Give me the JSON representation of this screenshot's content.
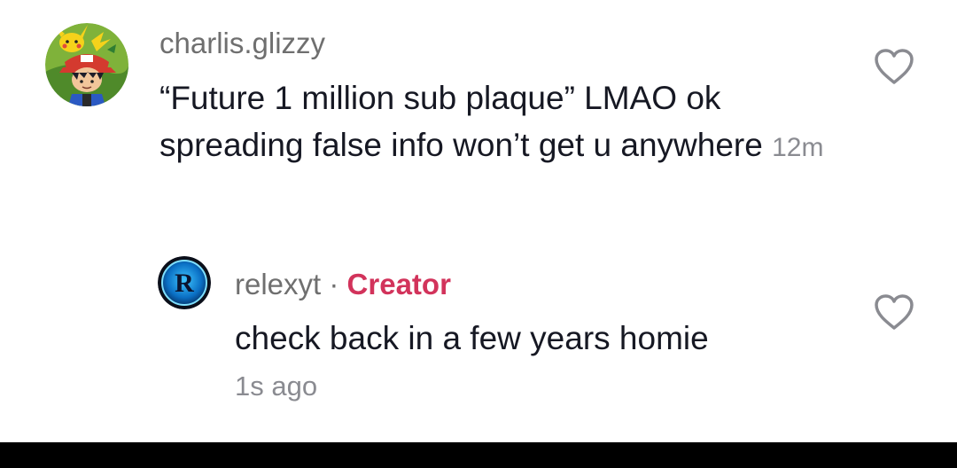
{
  "comments": [
    {
      "username": "charlis.glizzy",
      "text": "“Future 1 million sub plaque” LMAO ok spreading false info won’t get u anywhere",
      "time": "12m",
      "avatar_icon": "pikachu-ash-avatar-icon",
      "like_icon": "heart-outline-icon"
    }
  ],
  "replies": [
    {
      "username": "relexyt",
      "separator": "·",
      "badge": "Creator",
      "text": "check back in a few years homie",
      "time": "1s ago",
      "avatar_icon": "letter-r-avatar-icon",
      "like_icon": "heart-outline-icon"
    }
  ],
  "colors": {
    "creator_badge": "#d2335b",
    "username": "#6f6f6f",
    "timestamp": "#8a8b91",
    "text": "#161823"
  }
}
